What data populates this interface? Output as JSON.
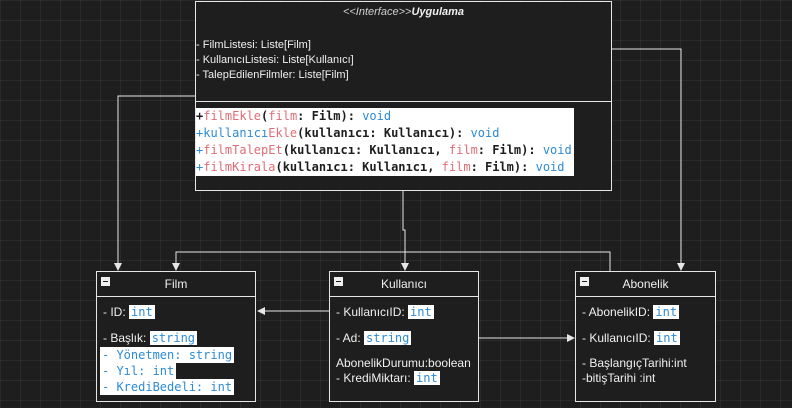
{
  "interface": {
    "stereotype": "<<Interface>>",
    "name": "Uygulama",
    "attributes": [
      " - FilmListesi: Liste[Film]",
      " - KullanıcıListesi: Liste[Kullanıcı]",
      "- TalepEdilenFilmler: Liste[Film]"
    ],
    "methods": [
      [
        {
          "t": "+",
          "c": "p"
        },
        {
          "t": "filmEkle",
          "c": "k"
        },
        {
          "t": "(",
          "c": "p"
        },
        {
          "t": "film",
          "c": "k"
        },
        {
          "t": ": Film): ",
          "c": "p"
        },
        {
          "t": "void",
          "c": "t"
        }
      ],
      [
        {
          "t": "+kullanıcı",
          "c": "t"
        },
        {
          "t": "Ekle",
          "c": "k"
        },
        {
          "t": "(kullanıcı: Kullanıcı): ",
          "c": "p"
        },
        {
          "t": "void",
          "c": "t"
        }
      ],
      [
        {
          "t": "+",
          "c": "t"
        },
        {
          "t": "filmTalepEt",
          "c": "k"
        },
        {
          "t": "(kullanıcı: Kullanıcı, ",
          "c": "p"
        },
        {
          "t": "film",
          "c": "k"
        },
        {
          "t": ": Film): ",
          "c": "p"
        },
        {
          "t": "void",
          "c": "t"
        }
      ],
      [
        {
          "t": "+",
          "c": "t"
        },
        {
          "t": "filmKirala",
          "c": "k"
        },
        {
          "t": "(kullanıcı: Kullanıcı, ",
          "c": "p"
        },
        {
          "t": "film",
          "c": "k"
        },
        {
          "t": ": Film): ",
          "c": "p"
        },
        {
          "t": "void",
          "c": "t"
        }
      ]
    ]
  },
  "film": {
    "title": "Film",
    "id_label": "- ID: ",
    "id_type": "int",
    "baslik_label": "- Başlık: ",
    "baslik_type": "string",
    "yonetmen": "- Yönetmen: string",
    "yil": "- Yıl: int",
    "kredi": "- KrediBedeli: int"
  },
  "kullanici": {
    "title": "Kullanıcı",
    "id_label": "- KullanıcıID: ",
    "id_type": "int",
    "ad_label": "- Ad: ",
    "ad_type": "string",
    "durum": "AbonelikDurumu:boolean",
    "kredi_label": "- KrediMiktarı: ",
    "kredi_type": "int"
  },
  "abonelik": {
    "title": "Abonelik",
    "id_label": "- AbonelikID: ",
    "id_type": "int",
    "kid_label": "- KullanıcıID: ",
    "kid_type": "int",
    "baslangic": "- BaşlangıçTarihi:int",
    "bitis": "-bitişTarihi :int"
  }
}
